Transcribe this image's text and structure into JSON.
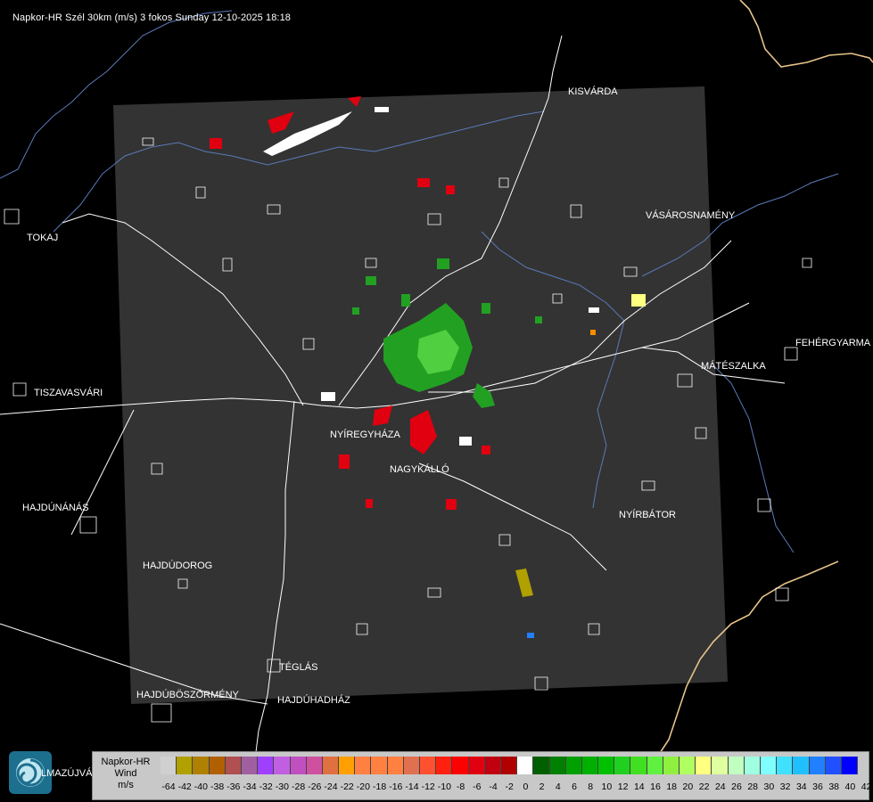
{
  "header": {
    "title": "Napkor-HR Szél 30km (m/s) 3 fokos Sunday 12-10-2025 18:18"
  },
  "cities": [
    {
      "id": "kisvarda",
      "name": "KISVÁRDA"
    },
    {
      "id": "vasarosnameny",
      "name": "VÁSÁROSNAMÉNY"
    },
    {
      "id": "tokaj",
      "name": "TOKAJ"
    },
    {
      "id": "fehergyarmat",
      "name": "FEHÉRGYARMA"
    },
    {
      "id": "mateszalka",
      "name": "MÁTÉSZALKA"
    },
    {
      "id": "tiszavasvari",
      "name": "TISZAVASVÁRI"
    },
    {
      "id": "nyiregyhaza",
      "name": "NYÍREGYHÁZA"
    },
    {
      "id": "nagykallo",
      "name": "NAGYKÁLLÓ"
    },
    {
      "id": "nyirbator",
      "name": "NYÍRBÁTOR"
    },
    {
      "id": "hajdunanas",
      "name": "HAJDÚNÁNÁS"
    },
    {
      "id": "hajdudorog",
      "name": "HAJDÚDOROG"
    },
    {
      "id": "teglas",
      "name": "TÉGLÁS"
    },
    {
      "id": "hajduboszormeny",
      "name": "HAJDÚBÖSZÖRMÉNY"
    },
    {
      "id": "hajduhadhaz",
      "name": "HAJDÚHADHÁZ"
    },
    {
      "id": "balmazujvaros",
      "name": "LMAZÚJVÁR"
    }
  ],
  "roads": [
    "26",
    "41",
    "35",
    "4"
  ],
  "legend": {
    "label_line1": "Napkor-HR",
    "label_line2": "Wind",
    "label_line3": "m/s",
    "colors": [
      "#d0d0d0",
      "#b0a000",
      "#b08000",
      "#b06000",
      "#b05050",
      "#a060a0",
      "#a040ff",
      "#c060e0",
      "#c050c0",
      "#d050a0",
      "#e07040",
      "#ffa000",
      "#ff8040",
      "#ff8040",
      "#ff8040",
      "#e07050",
      "#ff5030",
      "#ff2010",
      "#ff0000",
      "#e00010",
      "#c00010",
      "#b00000",
      "#ffffff",
      "#006000",
      "#008000",
      "#00a000",
      "#00b000",
      "#00c000",
      "#20d020",
      "#40e020",
      "#60f040",
      "#90f040",
      "#b0ff60",
      "#ffff80",
      "#e0ffa0",
      "#c0ffc0",
      "#a0ffe0",
      "#80ffff",
      "#40e0ff",
      "#20c0ff",
      "#2080ff",
      "#2050ff",
      "#0000ff"
    ],
    "ticks": [
      "-64",
      "-42",
      "-40",
      "-38",
      "-36",
      "-34",
      "-32",
      "-30",
      "-28",
      "-26",
      "-24",
      "-22",
      "-20",
      "-18",
      "-16",
      "-14",
      "-12",
      "-10",
      "-8",
      "-6",
      "-4",
      "-2",
      "0",
      "2",
      "4",
      "6",
      "8",
      "10",
      "12",
      "14",
      "16",
      "18",
      "20",
      "22",
      "24",
      "26",
      "28",
      "30",
      "32",
      "34",
      "36",
      "38",
      "40",
      "42"
    ]
  }
}
